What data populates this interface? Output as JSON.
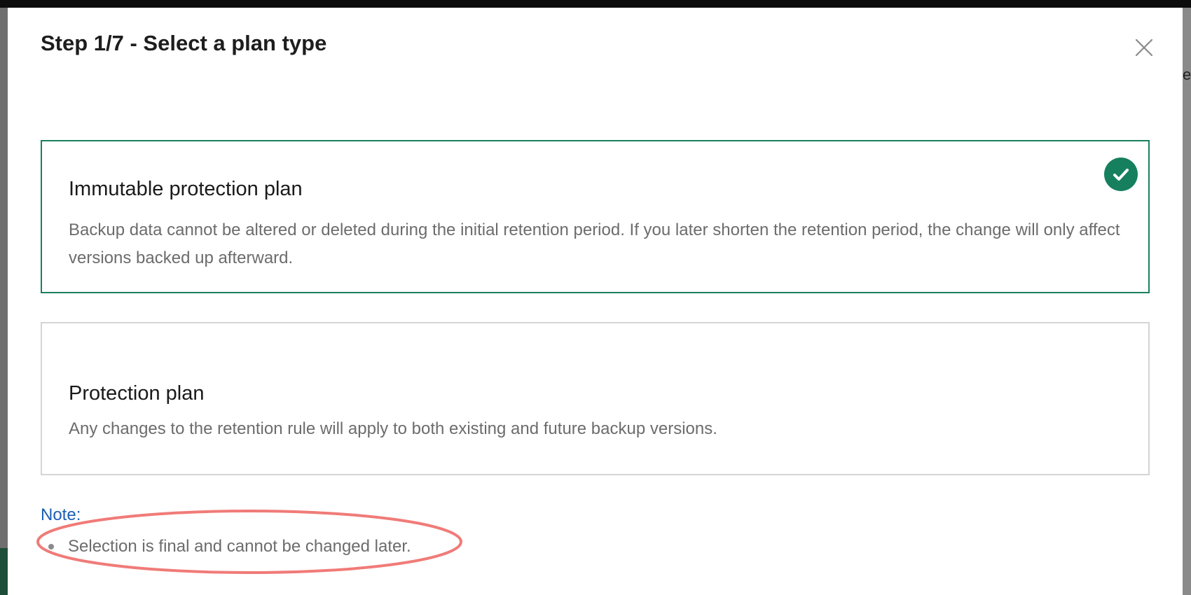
{
  "modal": {
    "title": "Step 1/7 - Select a plan type",
    "close_icon": "close-icon"
  },
  "plans": [
    {
      "title": "Immutable protection plan",
      "description": "Backup data cannot be altered or deleted during the initial retention period. If you later shorten the retention period, the change will only affect versions backed up afterward.",
      "selected": true,
      "selected_icon": "checkmark-icon"
    },
    {
      "title": "Protection plan",
      "description": "Any changes to the retention rule will apply to both existing and future backup versions.",
      "selected": false
    }
  ],
  "note": {
    "label": "Note:",
    "items": [
      "Selection is final and cannot be changed later."
    ]
  },
  "background": {
    "partial_text": "e"
  },
  "colors": {
    "accent_green": "#16805e",
    "selected_border": "#1a7f5f",
    "note_blue": "#1c5fb3",
    "highlight_oval": "#f07b78"
  }
}
